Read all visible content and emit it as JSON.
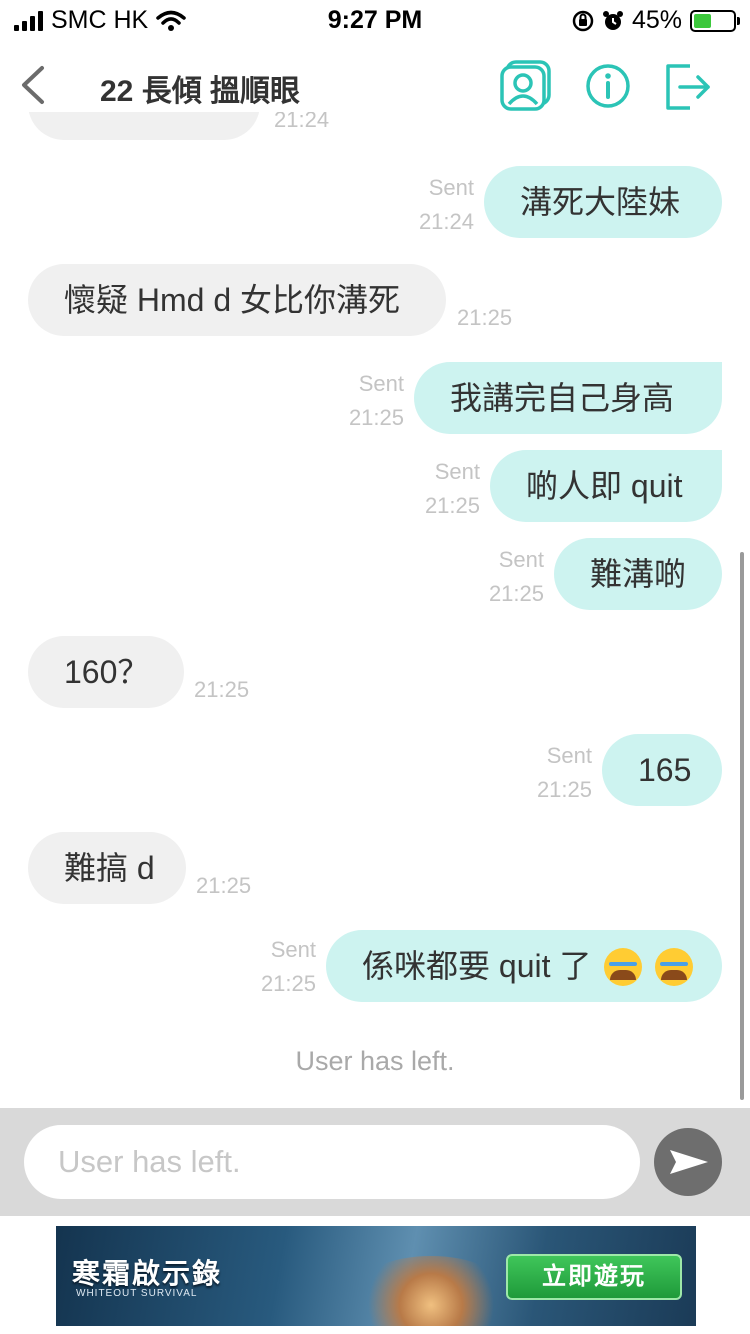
{
  "status_bar": {
    "carrier": "SMC HK",
    "time": "9:27 PM",
    "battery": "45%",
    "battery_level": 0.45
  },
  "header": {
    "title": "22 長傾 搵順眼",
    "accent_color": "#2bc4b6"
  },
  "messages": [
    {
      "side": "in",
      "text": "",
      "time": "21:24"
    },
    {
      "side": "out",
      "status": "Sent",
      "text": "溝死大陸妹",
      "time": "21:24"
    },
    {
      "side": "in",
      "text": "懷疑 Hmd d 女比你溝死",
      "time": "21:25"
    },
    {
      "side": "out",
      "status": "Sent",
      "text": "我講完自己身高",
      "time": "21:25"
    },
    {
      "side": "out",
      "status": "Sent",
      "text": "啲人即 quit",
      "time": "21:25"
    },
    {
      "side": "out",
      "status": "Sent",
      "text": "難溝啲",
      "time": "21:25"
    },
    {
      "side": "in",
      "text": "160？",
      "time": "21:25"
    },
    {
      "side": "out",
      "status": "Sent",
      "text": "165",
      "time": "21:25"
    },
    {
      "side": "in",
      "text": "難搞 d",
      "time": "21:25"
    },
    {
      "side": "out",
      "status": "Sent",
      "text": "係咪都要 quit 了",
      "emoji": [
        "loudly-crying-face",
        "loudly-crying-face"
      ],
      "time": "21:25"
    }
  ],
  "system_message": "User has left.",
  "input": {
    "placeholder": "User has left."
  },
  "ad": {
    "title": "寒霜啟示錄",
    "subtitle": "WHITEOUT SURVIVAL",
    "button": "立即遊玩"
  }
}
